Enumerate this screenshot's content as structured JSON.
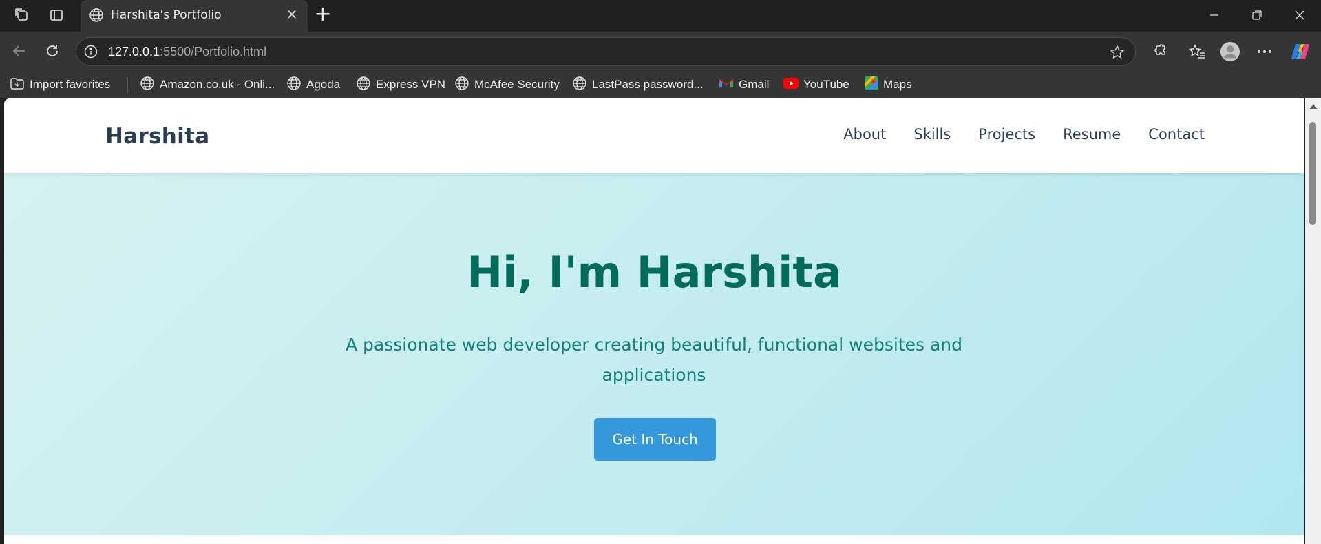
{
  "browser": {
    "tab": {
      "title": "Harshita's Portfolio",
      "icon": "globe-icon"
    },
    "address": {
      "host": "127.0.0.1",
      "rest": ":5500/Portfolio.html"
    },
    "bookmarks": [
      {
        "label": "Import favorites",
        "icon": "import-favorites-icon"
      },
      {
        "label": "Amazon.co.uk - Onli...",
        "icon": "globe-icon"
      },
      {
        "label": "Agoda",
        "icon": "globe-icon"
      },
      {
        "label": "Express VPN",
        "icon": "globe-icon"
      },
      {
        "label": "McAfee Security",
        "icon": "globe-icon"
      },
      {
        "label": "LastPass password...",
        "icon": "globe-icon"
      },
      {
        "label": "Gmail",
        "icon": "gmail-icon"
      },
      {
        "label": "YouTube",
        "icon": "youtube-icon"
      },
      {
        "label": "Maps",
        "icon": "maps-icon"
      }
    ]
  },
  "site": {
    "logo": "Harshita",
    "nav": [
      "About",
      "Skills",
      "Projects",
      "Resume",
      "Contact"
    ],
    "hero": {
      "title": "Hi, I'm Harshita",
      "subtitle": "A passionate web developer creating beautiful, functional websites and applications",
      "cta": "Get In Touch"
    }
  },
  "colors": {
    "logo": "#2c3e50",
    "hero_title": "#036b5a",
    "hero_subtitle": "#14807a",
    "cta_background": "#3498db",
    "hero_gradient_start": "#d7f1f1",
    "hero_gradient_end": "#b1e7ee"
  }
}
